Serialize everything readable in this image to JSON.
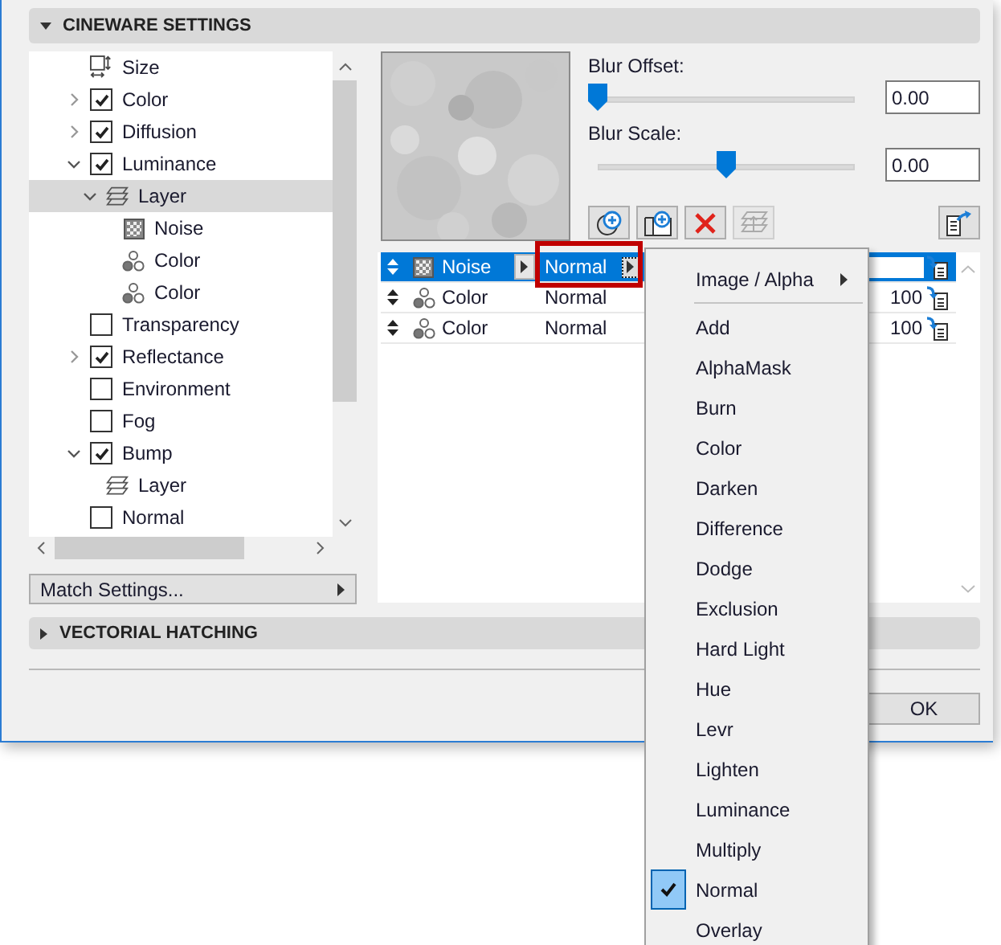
{
  "sections": [
    {
      "title": "CINEWARE SETTINGS",
      "expanded": true
    },
    {
      "title": "VECTORIAL HATCHING",
      "expanded": false
    }
  ],
  "tree": {
    "items": [
      {
        "kind": "size",
        "label": "Size",
        "selected": false
      },
      {
        "kind": "channel",
        "label": "Color",
        "checked": true,
        "expanded": false,
        "selected": false
      },
      {
        "kind": "channel",
        "label": "Diffusion",
        "checked": true,
        "expanded": false,
        "selected": false
      },
      {
        "kind": "channel",
        "label": "Luminance",
        "checked": true,
        "expanded": true,
        "selected": false,
        "children": [
          {
            "kind": "layer",
            "label": "Layer",
            "expanded": true,
            "selected": true,
            "children": [
              {
                "kind": "noise",
                "label": "Noise",
                "selected": false
              },
              {
                "kind": "color",
                "label": "Color",
                "selected": false
              },
              {
                "kind": "color",
                "label": "Color",
                "selected": false
              }
            ]
          }
        ]
      },
      {
        "kind": "channel",
        "label": "Transparency",
        "checked": false,
        "selected": false
      },
      {
        "kind": "channel",
        "label": "Reflectance",
        "checked": true,
        "expanded": false,
        "selected": false
      },
      {
        "kind": "channel",
        "label": "Environment",
        "checked": false,
        "selected": false
      },
      {
        "kind": "channel",
        "label": "Fog",
        "checked": false,
        "selected": false
      },
      {
        "kind": "channel",
        "label": "Bump",
        "checked": true,
        "expanded": true,
        "selected": false,
        "children": [
          {
            "kind": "layer",
            "label": "Layer",
            "selected": false
          }
        ]
      },
      {
        "kind": "channel",
        "label": "Normal",
        "checked": false,
        "selected": false
      }
    ]
  },
  "match_button": {
    "label": "Match Settings..."
  },
  "sliders": [
    {
      "label": "Blur Offset:",
      "level": 0,
      "value": "0.00"
    },
    {
      "label": "Blur Scale:",
      "level": 0.5,
      "value": "0.00"
    }
  ],
  "toolbar": [
    {
      "kind": "add-shader",
      "disabled": false
    },
    {
      "kind": "add-folder",
      "disabled": false
    },
    {
      "kind": "delete",
      "disabled": false
    },
    {
      "kind": "merge",
      "disabled": true
    },
    {
      "kind": "export",
      "disabled": false
    }
  ],
  "layers": [
    {
      "kind": "noise",
      "name": "Noise",
      "mode": "Normal",
      "selected": true,
      "highlighted": true
    },
    {
      "kind": "color",
      "name": "Color",
      "mode": "Normal",
      "opacity": "100",
      "selected": false,
      "highlighted": false
    },
    {
      "kind": "color",
      "name": "Color",
      "mode": "Normal",
      "opacity": "100",
      "selected": false,
      "highlighted": false
    }
  ],
  "menu": {
    "items": [
      {
        "kind": "submenu",
        "label": "Image / Alpha"
      },
      {
        "kind": "separator"
      },
      {
        "kind": "item",
        "label": "Add",
        "checked": false
      },
      {
        "kind": "item",
        "label": "AlphaMask",
        "checked": false
      },
      {
        "kind": "item",
        "label": "Burn",
        "checked": false
      },
      {
        "kind": "item",
        "label": "Color",
        "checked": false
      },
      {
        "kind": "item",
        "label": "Darken",
        "checked": false
      },
      {
        "kind": "item",
        "label": "Difference",
        "checked": false
      },
      {
        "kind": "item",
        "label": "Dodge",
        "checked": false
      },
      {
        "kind": "item",
        "label": "Exclusion",
        "checked": false
      },
      {
        "kind": "item",
        "label": "Hard Light",
        "checked": false
      },
      {
        "kind": "item",
        "label": "Hue",
        "checked": false
      },
      {
        "kind": "item",
        "label": "Levr",
        "checked": false
      },
      {
        "kind": "item",
        "label": "Lighten",
        "checked": false
      },
      {
        "kind": "item",
        "label": "Luminance",
        "checked": false
      },
      {
        "kind": "item",
        "label": "Multiply",
        "checked": false
      },
      {
        "kind": "item",
        "label": "Normal",
        "checked": true
      },
      {
        "kind": "item",
        "label": "Overlay",
        "checked": false
      }
    ]
  },
  "ok_button": {
    "label": "OK"
  }
}
